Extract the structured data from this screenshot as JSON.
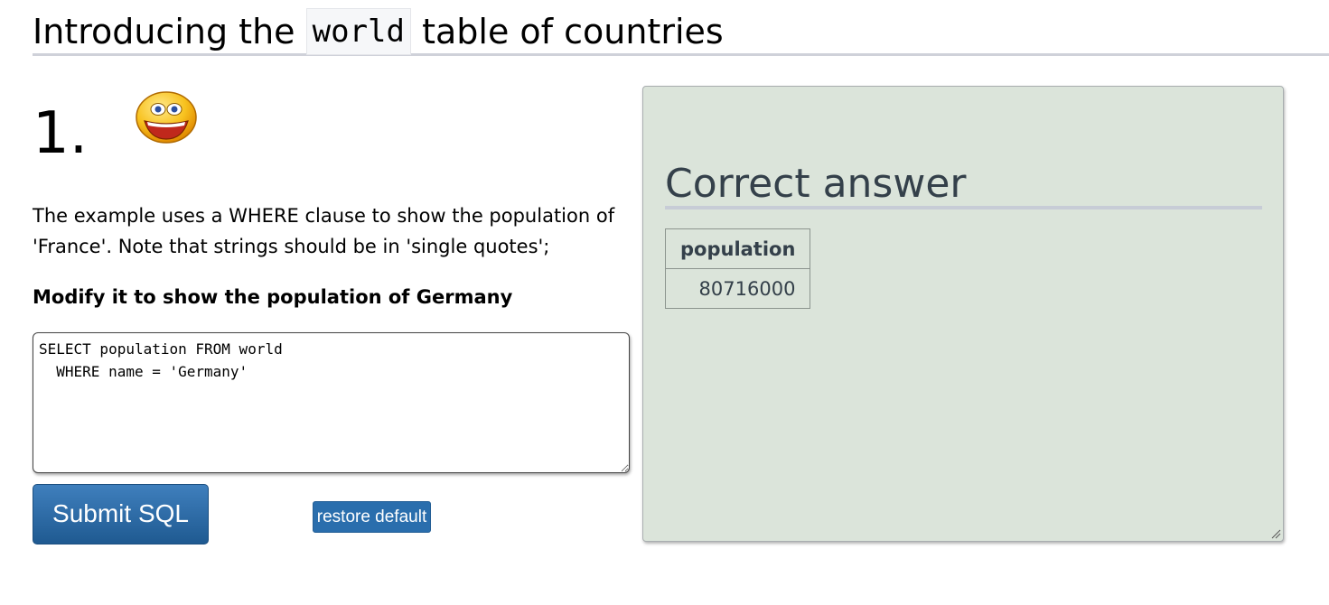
{
  "title": {
    "prefix": "Introducing the",
    "code": "world",
    "suffix": "table of countries"
  },
  "question": {
    "number": "1.",
    "description": "The example uses a WHERE clause to show the population of 'France'. Note that strings should be in 'single quotes';",
    "task": "Modify it to show the population of Germany"
  },
  "editor": {
    "value": "SELECT population FROM world\n  WHERE name = 'Germany'"
  },
  "buttons": {
    "submit": "Submit SQL",
    "restore": "restore default"
  },
  "answer": {
    "heading": "Correct answer",
    "columns": [
      "population"
    ],
    "rows": [
      [
        "80716000"
      ]
    ]
  },
  "icons": {
    "smiley": "smiley-face-icon",
    "resize": "resize-grip-icon"
  },
  "colors": {
    "button_blue": "#2a6ead",
    "answer_bg": "#dbe4da",
    "heading_text": "#34404a"
  }
}
